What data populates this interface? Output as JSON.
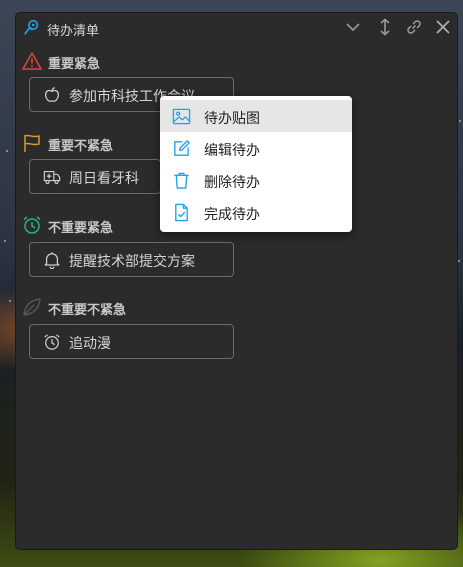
{
  "window": {
    "title": "待办清单",
    "toolbar": {
      "collapse_icon": "chevron-down-icon",
      "resize_icon": "vertical-resize-icon",
      "pin_icon": "link-icon",
      "close_icon": "close-icon"
    }
  },
  "groups": [
    {
      "title": "重要紧急",
      "icon": "warning-triangle-icon",
      "color": "#e0443e",
      "tasks": [
        {
          "label": "参加市科技工作会议",
          "icon": "apple-icon"
        }
      ]
    },
    {
      "title": "重要不紧急",
      "icon": "flag-icon",
      "color": "#d49a2a",
      "tasks": [
        {
          "label": "周日看牙科",
          "icon": "ambulance-icon"
        }
      ]
    },
    {
      "title": "不重要紧急",
      "icon": "alarm-clock-icon",
      "color": "#27b37e",
      "tasks": [
        {
          "label": "提醒技术部提交方案",
          "icon": "bell-icon"
        }
      ]
    },
    {
      "title": "不重要不紧急",
      "icon": "leaf-icon",
      "color": "#555555",
      "tasks": [
        {
          "label": "追动漫",
          "icon": "alarm-clock-icon"
        }
      ]
    }
  ],
  "context_menu": {
    "items": [
      {
        "label": "待办贴图",
        "icon": "image-icon"
      },
      {
        "label": "编辑待办",
        "icon": "edit-icon"
      },
      {
        "label": "删除待办",
        "icon": "trash-icon"
      },
      {
        "label": "完成待办",
        "icon": "file-check-icon"
      }
    ],
    "accent": "#1aa3e8"
  }
}
